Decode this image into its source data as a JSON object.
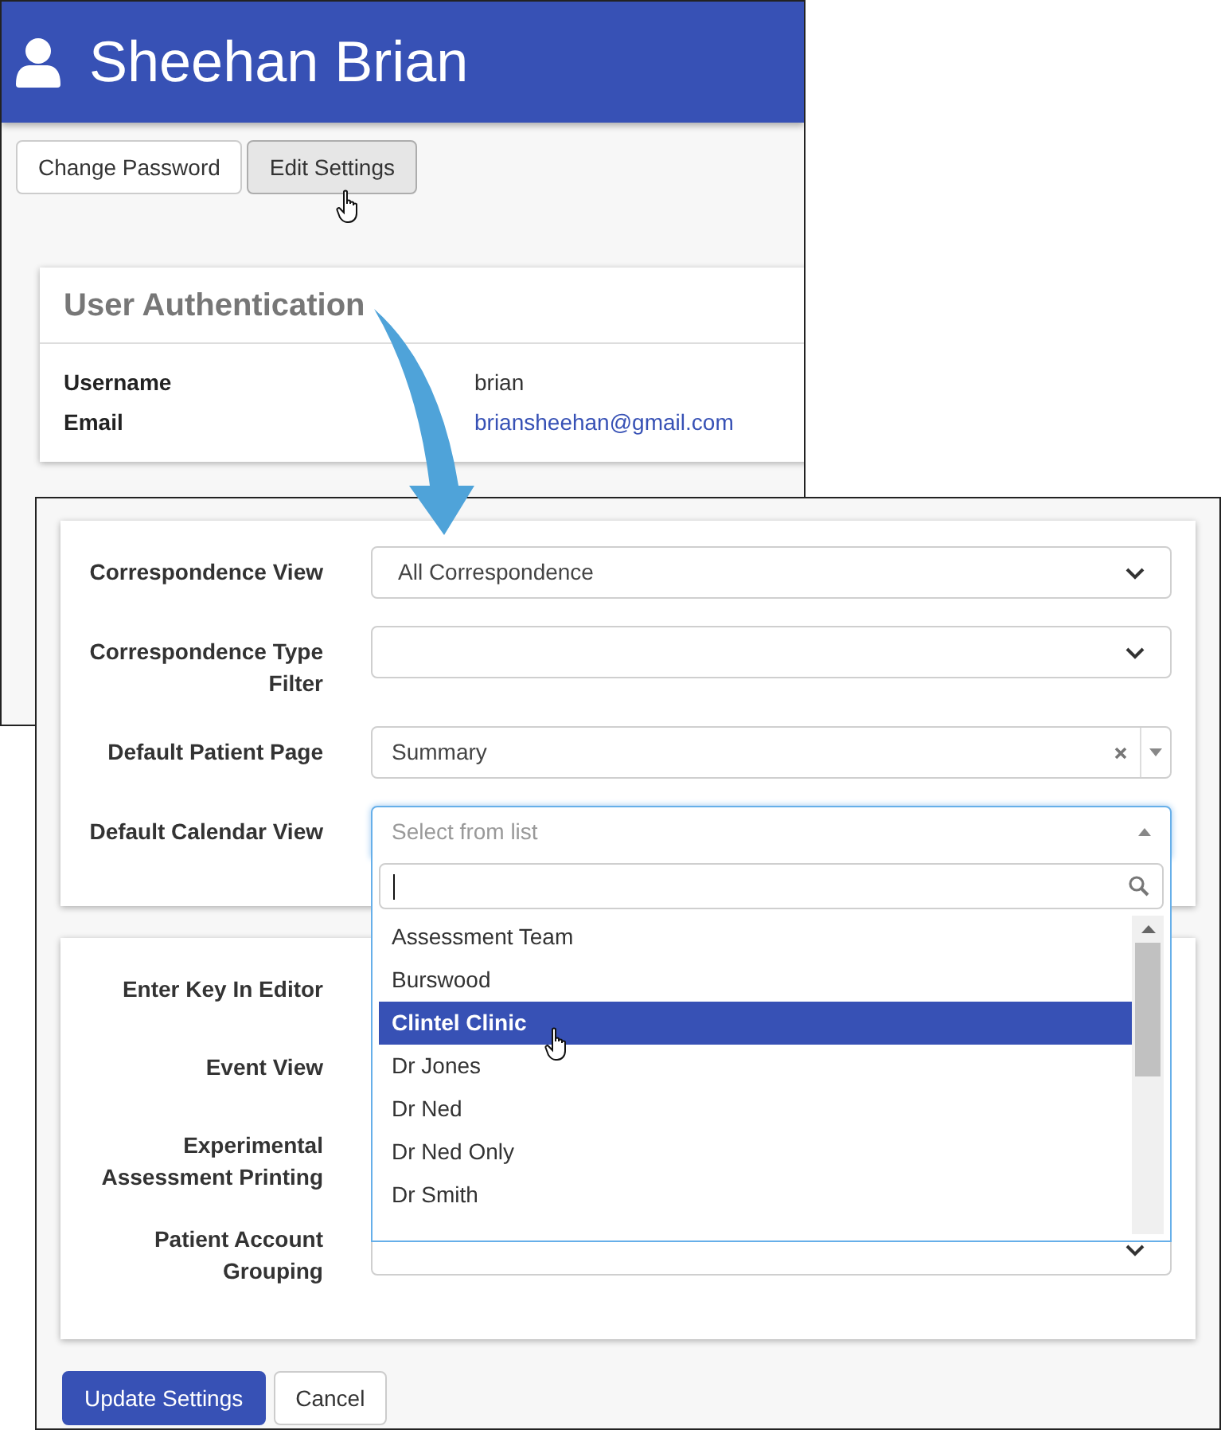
{
  "back_window": {
    "user_name": "Sheehan Brian",
    "buttons": [
      {
        "label": "Change Password",
        "selected": false
      },
      {
        "label": "Edit Settings",
        "selected": true
      }
    ],
    "card": {
      "title": "User Authentication",
      "fields": [
        {
          "label": "Username",
          "value": "brian",
          "kind": "text"
        },
        {
          "label": "Email",
          "value": "briansheehan@gmail.com",
          "kind": "link"
        }
      ]
    }
  },
  "front_window": {
    "settings_top": [
      {
        "label": "Correspondence View",
        "kind": "select",
        "value": "All Correspondence"
      },
      {
        "label": "Correspondence Type Filter",
        "kind": "select"
      },
      {
        "label": "Default Patient Page",
        "kind": "clearable",
        "value": "Summary"
      },
      {
        "label": "Default Calendar View",
        "kind": "combo",
        "placeholder": "Select from list",
        "expanded": true
      }
    ],
    "dropdown_items": [
      {
        "label": "Assessment Team",
        "selected": false
      },
      {
        "label": "Burswood",
        "selected": false
      },
      {
        "label": "Clintel Clinic",
        "selected": true
      },
      {
        "label": "Dr Jones",
        "selected": false
      },
      {
        "label": "Dr Ned",
        "selected": false
      },
      {
        "label": "Dr Ned Only",
        "selected": false
      },
      {
        "label": "Dr Smith",
        "selected": false
      }
    ],
    "settings_bottom": [
      {
        "label": "Enter Key In Editor",
        "kind": "hidden"
      },
      {
        "label": "Event View",
        "kind": "hidden"
      },
      {
        "label": "Experimental Assessment Printing",
        "kind": "hidden"
      },
      {
        "label": "Patient Account Grouping",
        "kind": "select"
      }
    ],
    "buttons": [
      {
        "label": "Update Settings",
        "kind": "primary"
      },
      {
        "label": "Cancel",
        "kind": "secondary"
      }
    ]
  }
}
